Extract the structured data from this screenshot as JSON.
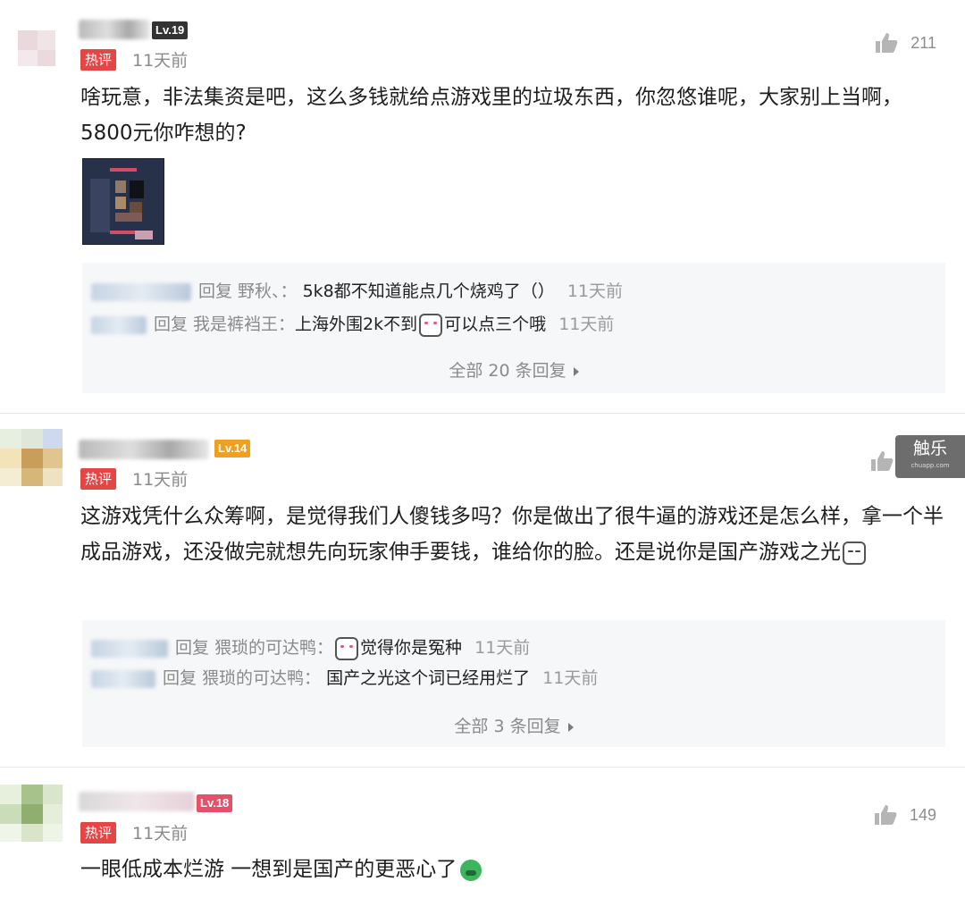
{
  "comments": [
    {
      "level": "Lv.19",
      "level_color": "#333333",
      "hot_label": "热评",
      "time": "11天前",
      "likes": "211",
      "text": "啥玩意，非法集资是吧，这么多钱就给点游戏里的垃圾东西，你忽悠谁呢，大家别上当啊，5800元你咋想的?",
      "replies": [
        {
          "prefix": "回复 野秋、：",
          "text": "5k8都不知道能点几个烧鸡了（）",
          "time": "11天前"
        },
        {
          "prefix": "回复 我是裤裆王：",
          "text_a": "上海外围2k不到",
          "text_b": "可以点三个哦",
          "time": "11天前"
        }
      ],
      "more": "全部 20 条回复"
    },
    {
      "level": "Lv.14",
      "level_color": "#f0a020",
      "hot_label": "热评",
      "time": "11天前",
      "text": "这游戏凭什么众筹啊，是觉得我们人傻钱多吗？你是做出了很牛逼的游戏还是怎么样，拿一个半成品游戏，还没做完就想先向玩家伸手要钱，谁给你的脸。还是说你是国产游戏之光",
      "replies": [
        {
          "prefix": "回复 猥琐的可达鸭：",
          "text": "觉得你是冤种",
          "time": "11天前"
        },
        {
          "prefix": "回复 猥琐的可达鸭：",
          "text": "国产之光这个词已经用烂了",
          "time": "11天前"
        }
      ],
      "more": "全部 3 条回复"
    },
    {
      "level": "Lv.18",
      "level_color": "#e8506a",
      "hot_label": "热评",
      "time": "11天前",
      "likes": "149",
      "text": "一眼低成本烂游 一想到是国产的更恶心了"
    }
  ],
  "watermark": {
    "text": "触乐",
    "sub": "chuapp.com"
  }
}
